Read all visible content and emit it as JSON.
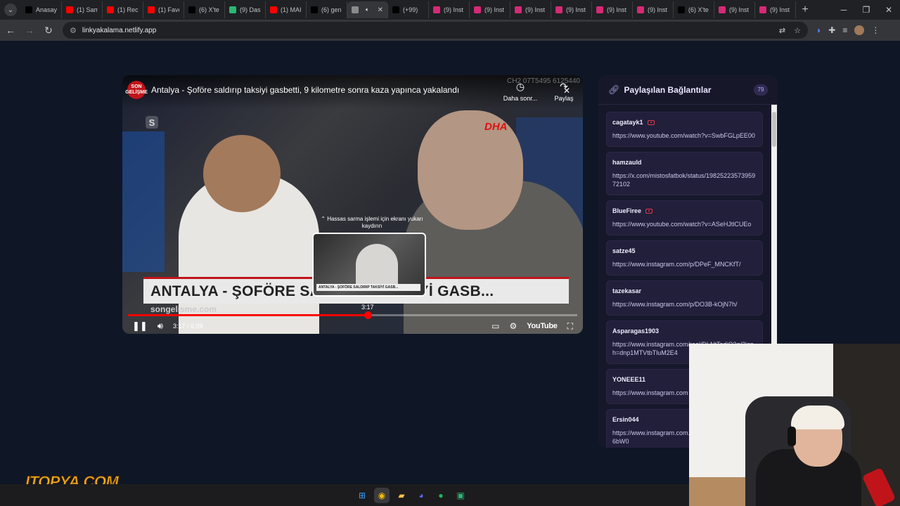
{
  "browser": {
    "tabs": [
      {
        "label": "Anasay",
        "favicon_color": "#000000",
        "icon": "x-logo-icon"
      },
      {
        "label": "(1) Sam",
        "favicon_color": "#ff0000",
        "icon": "youtube-icon"
      },
      {
        "label": "(1) Reck",
        "favicon_color": "#ff0000",
        "icon": "youtube-icon"
      },
      {
        "label": "(1) Fave",
        "favicon_color": "#ff0000",
        "icon": "youtube-icon"
      },
      {
        "label": "(6) X'te",
        "favicon_color": "#000000",
        "icon": "x-logo-icon"
      },
      {
        "label": "(9) Dash",
        "favicon_color": "#2bb673",
        "icon": "app-icon"
      },
      {
        "label": "(1) MAI",
        "favicon_color": "#ff0000",
        "icon": "youtube-icon"
      },
      {
        "label": "(6) gen",
        "favicon_color": "#000000",
        "icon": "x-logo-icon"
      },
      {
        "label": "",
        "favicon_color": "#8a8a8a",
        "icon": "globe-icon",
        "active": true
      },
      {
        "label": "(+99)",
        "favicon_color": "#000000",
        "icon": "tiktok-icon"
      },
      {
        "label": "(9) Inst",
        "favicon_color": "#d62976",
        "icon": "instagram-icon"
      },
      {
        "label": "(9) Inst",
        "favicon_color": "#d62976",
        "icon": "instagram-icon"
      },
      {
        "label": "(9) Inst",
        "favicon_color": "#d62976",
        "icon": "instagram-icon"
      },
      {
        "label": "(9) Inst",
        "favicon_color": "#d62976",
        "icon": "instagram-icon"
      },
      {
        "label": "(9) Inst",
        "favicon_color": "#d62976",
        "icon": "instagram-icon"
      },
      {
        "label": "(9) Inst",
        "favicon_color": "#d62976",
        "icon": "instagram-icon"
      },
      {
        "label": "(6) X'te",
        "favicon_color": "#000000",
        "icon": "x-logo-icon"
      },
      {
        "label": "(9) Inst",
        "favicon_color": "#d62976",
        "icon": "instagram-icon"
      },
      {
        "label": "(9) Inst",
        "favicon_color": "#d62976",
        "icon": "instagram-icon"
      }
    ],
    "url": "linkyakalama.netlify.app"
  },
  "player": {
    "channel_logo": "SON GELİŞME",
    "title": "Antalya - Şoföre saldırıp taksiyi gasbetti, 9 kilometre sonra kaza yapınca yakalandı",
    "watermark_code": "CH2 07T5495 6125440",
    "watch_later_label": "Daha sonr...",
    "share_label": "Paylaş",
    "dha_logo": "DHA",
    "s_logo": "S",
    "lower_third": "ANTALYA - ŞOFÖRE SALDIRIP TAKSİYİ GASB...",
    "site_watermark": "songelisme.com",
    "scrub_hint": "⌃ Hassas sarma işlemi için ekranı yukarı kaydırın",
    "preview_caption": "ANTALYA - ŞOFÖRE SALDIRIP TAKSİYİ GASB...",
    "scrub_time": "3:17",
    "time_display": "3:17 / 6:09",
    "progress_fraction": 0.534,
    "youtube_label": "YouTube"
  },
  "panel": {
    "title": "Paylaşılan Bağlantılar",
    "count": "79",
    "links": [
      {
        "user": "cagatayk1",
        "youtube": true,
        "url": "https://www.youtube.com/watch?v=SwbFGLpEE00"
      },
      {
        "user": "hamzauld",
        "youtube": false,
        "url": "https://x.com/mistosfatbok/status/1982522357395972102"
      },
      {
        "user": "BlueFiree",
        "youtube": true,
        "url": "https://www.youtube.com/watch?v=ASeHJtlCUEo"
      },
      {
        "user": "satze45",
        "youtube": false,
        "url": "https://www.instagram.com/p/DPeF_MNCKfT/"
      },
      {
        "user": "tazekasar",
        "youtube": false,
        "url": "https://www.instagram.com/p/DO3B-kOjN7h/"
      },
      {
        "user": "Asparagas1903",
        "youtube": false,
        "url": "https://www.instagram.com/reel/DLNtTadiQ2q/?igsh=dnp1MTVtbTluM2E4"
      },
      {
        "user": "YONEEE11",
        "youtube": false,
        "url": "https://www.instagram.com"
      },
      {
        "user": "Ersin044",
        "youtube": false,
        "url": "https://www.instagram.com... igsh=MXcwZW92Y2l6bW0"
      }
    ]
  },
  "overlay": {
    "brand": "ITOPYA.COM"
  },
  "taskbar": {
    "icons": [
      "windows-start-icon",
      "chrome-icon",
      "file-explorer-icon",
      "discord-icon",
      "spotify-icon",
      "app-icon"
    ]
  }
}
